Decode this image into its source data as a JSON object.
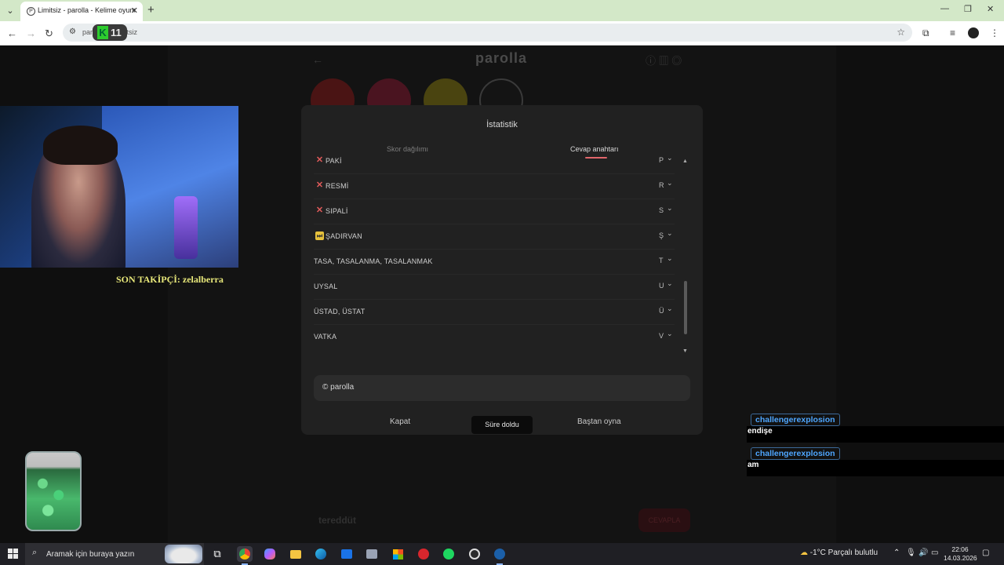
{
  "browser": {
    "tab_title": "Limitsiz - parolla - Kelime oyunu",
    "tab_favicon": "P",
    "url_prefix": "paro",
    "url_hidden_text": "org",
    "url_suffix": "imitsiz",
    "overlay_badge": {
      "letter": "K",
      "number": "11"
    }
  },
  "game": {
    "logo": "parolla",
    "circles": [
      {
        "color": "#4a1414"
      },
      {
        "color": "#4a1420"
      },
      {
        "color": "#4a4410"
      },
      {
        "color": "#141414"
      }
    ]
  },
  "stream": {
    "follower_label": "SON TAKİPÇİ: zelalberra"
  },
  "modal": {
    "title": "İstatistik",
    "tabs": [
      {
        "label": "Skor dağılımı",
        "active": false
      },
      {
        "label": "Cevap anahtarı",
        "active": true
      }
    ],
    "answers": [
      {
        "status": "wrong",
        "word": "PAKİ",
        "letter": "P"
      },
      {
        "status": "wrong",
        "word": "RESMİ",
        "letter": "R"
      },
      {
        "status": "wrong",
        "word": "SIPALİ",
        "letter": "S"
      },
      {
        "status": "pass",
        "word": "ŞADIRVAN",
        "letter": "Ş"
      },
      {
        "status": "none",
        "word": "TASA, TASALANMA, TASALANMAK",
        "letter": "T"
      },
      {
        "status": "none",
        "word": "UYSAL",
        "letter": "U"
      },
      {
        "status": "none",
        "word": "ÜSTAD, ÜSTAT",
        "letter": "Ü"
      },
      {
        "status": "none",
        "word": "VATKA",
        "letter": "V"
      }
    ],
    "copyright": "© parolla",
    "close_label": "Kapat",
    "toast": "Süre doldu",
    "restart_label": "Baştan oyna"
  },
  "underlay": {
    "input_value": "tereddüt",
    "button_label": "CEVAPLA"
  },
  "chat": [
    {
      "user": "challengerexplosion",
      "message": "endişe"
    },
    {
      "user": "challengerexplosion",
      "message": "am"
    }
  ],
  "taskbar": {
    "search_placeholder": "Aramak için buraya yazın",
    "weather": "-1°C  Parçalı bulutlu",
    "time": "22:06",
    "date": "14.03.2026"
  }
}
